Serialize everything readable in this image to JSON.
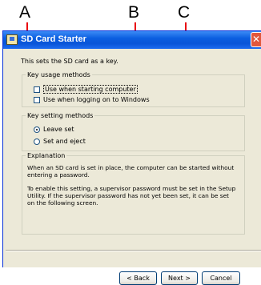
{
  "callouts": {
    "a": "A",
    "b": "B",
    "c": "C"
  },
  "window": {
    "title": "SD Card Starter"
  },
  "intro": "This sets the SD card as a key.",
  "key_usage": {
    "legend": "Key usage methods",
    "options": [
      "Use when starting computer",
      "Use when logging on to Windows"
    ],
    "checked": [
      false,
      false
    ]
  },
  "key_setting": {
    "legend": "Key setting methods",
    "options": [
      "Leave set",
      "Set and eject"
    ],
    "selected": "Leave set"
  },
  "explanation": {
    "legend": "Explanation",
    "p1": "When an SD card is set in place, the computer can be started without entering a password.",
    "p2": "To enable this setting, a supervisor password must be set in the Setup Utility. If the supervisor password has not yet been set, it can be set on the following screen."
  },
  "buttons": {
    "back": "< Back",
    "next": "Next >",
    "cancel": "Cancel"
  },
  "colors": {
    "callout_line": "#e8000b",
    "titlebar": "#0a55d8",
    "dialog_bg": "#ece9d8"
  }
}
